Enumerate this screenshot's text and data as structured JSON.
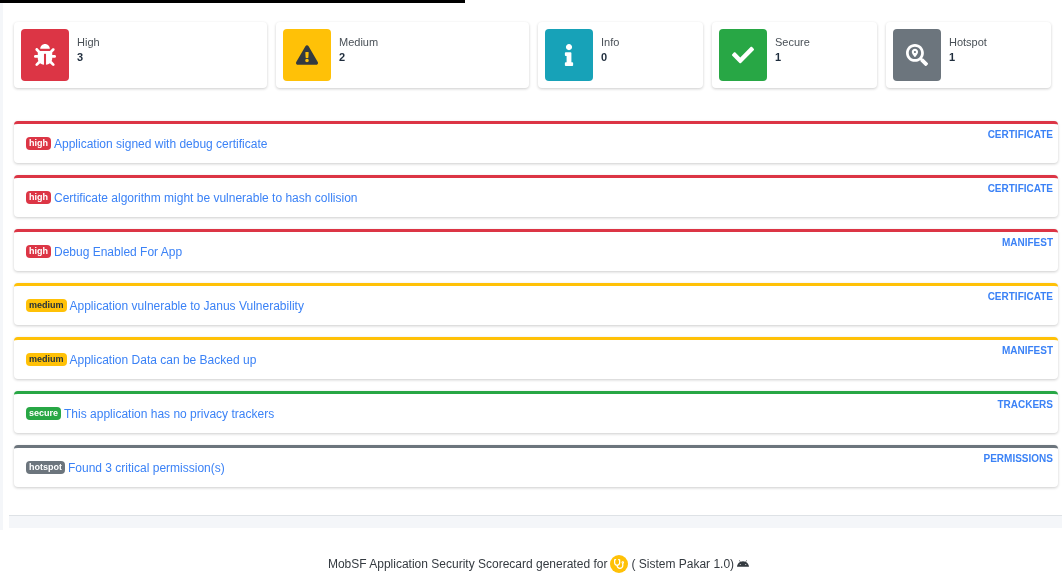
{
  "summary": [
    {
      "kind": "high",
      "label": "High",
      "count": "3"
    },
    {
      "kind": "medium",
      "label": "Medium",
      "count": "2"
    },
    {
      "kind": "info",
      "label": "Info",
      "count": "0"
    },
    {
      "kind": "secure",
      "label": "Secure",
      "count": "1"
    },
    {
      "kind": "hotspot",
      "label": "Hotspot",
      "count": "1"
    }
  ],
  "findings": [
    {
      "kind": "high",
      "badge": "high",
      "title": "Application signed with debug certificate",
      "category": "CERTIFICATE"
    },
    {
      "kind": "high",
      "badge": "high",
      "title": "Certificate algorithm might be vulnerable to hash collision",
      "category": "CERTIFICATE"
    },
    {
      "kind": "high",
      "badge": "high",
      "title": "Debug Enabled For App",
      "category": "MANIFEST"
    },
    {
      "kind": "medium",
      "badge": "medium",
      "title": "Application vulnerable to Janus Vulnerability",
      "category": "CERTIFICATE"
    },
    {
      "kind": "medium",
      "badge": "medium",
      "title": "Application Data can be Backed up",
      "category": "MANIFEST"
    },
    {
      "kind": "secure",
      "badge": "secure",
      "title": "This application has no privacy trackers",
      "category": "TRACKERS"
    },
    {
      "kind": "hotspot",
      "badge": "hotspot",
      "title": "Found 3 critical permission(s)",
      "category": "PERMISSIONS"
    }
  ],
  "footer": {
    "text": "MobSF Application Security Scorecard generated for",
    "app": "( Sistem Pakar 1.0)"
  }
}
